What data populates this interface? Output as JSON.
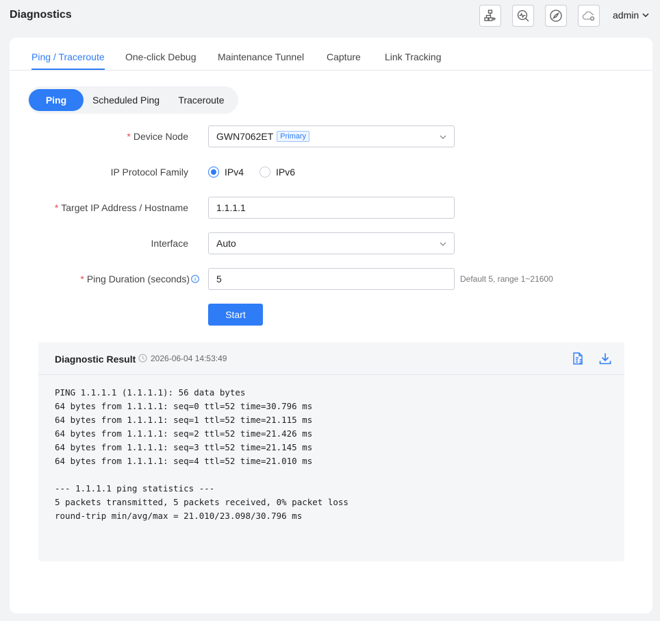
{
  "header": {
    "title": "Diagnostics",
    "user": "admin",
    "tools": [
      {
        "icon": "network-topology-icon"
      },
      {
        "icon": "search-diagnostics-icon"
      },
      {
        "icon": "compass-icon"
      },
      {
        "icon": "cloud-disconnected-icon"
      }
    ]
  },
  "tabs": [
    {
      "label": "Ping / Traceroute",
      "active": true
    },
    {
      "label": "One-click Debug"
    },
    {
      "label": "Maintenance Tunnel"
    },
    {
      "label": "Capture"
    },
    {
      "label": "Link Tracking"
    }
  ],
  "segments": [
    {
      "label": "Ping",
      "active": true
    },
    {
      "label": "Scheduled Ping"
    },
    {
      "label": "Traceroute"
    }
  ],
  "form": {
    "device_node": {
      "label": "Device Node",
      "value": "GWN7062ET",
      "badge": "Primary",
      "required": true
    },
    "ip_family": {
      "label": "IP Protocol Family",
      "options": [
        "IPv4",
        "IPv6"
      ],
      "selected": "IPv4"
    },
    "target": {
      "label": "Target IP Address / Hostname",
      "value": "1.1.1.1",
      "required": true
    },
    "interface": {
      "label": "Interface",
      "value": "Auto"
    },
    "duration": {
      "label": "Ping Duration (seconds)",
      "value": "5",
      "hint": "Default 5, range 1~21600",
      "required": true
    },
    "start_label": "Start"
  },
  "result": {
    "title": "Diagnostic Result",
    "timestamp": "2026-06-04 14:53:49",
    "lines": [
      "PING 1.1.1.1 (1.1.1.1): 56 data bytes",
      "64 bytes from 1.1.1.1: seq=0 ttl=52 time=30.796 ms",
      "64 bytes from 1.1.1.1: seq=1 ttl=52 time=21.115 ms",
      "64 bytes from 1.1.1.1: seq=2 ttl=52 time=21.426 ms",
      "64 bytes from 1.1.1.1: seq=3 ttl=52 time=21.145 ms",
      "64 bytes from 1.1.1.1: seq=4 ttl=52 time=21.010 ms",
      "",
      "--- 1.1.1.1 ping statistics ---",
      "5 packets transmitted, 5 packets received, 0% packet loss",
      "round-trip min/avg/max = 21.010/23.098/30.796 ms"
    ]
  },
  "colors": {
    "accent": "#2e7cf6",
    "required": "#e5484d"
  }
}
